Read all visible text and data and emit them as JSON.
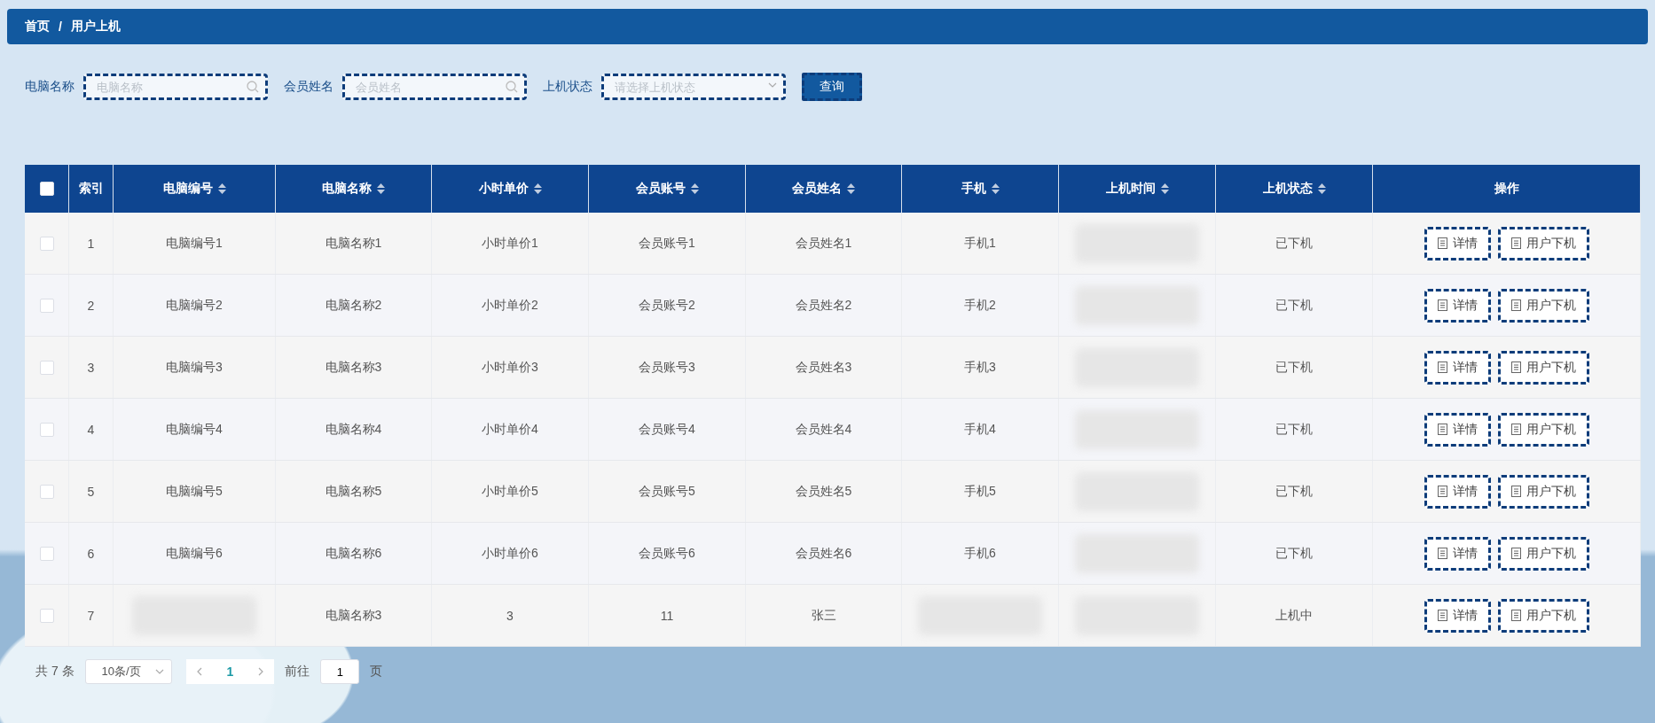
{
  "breadcrumb": [
    "首页",
    "用户上机"
  ],
  "breadcrumb_separator": "/",
  "filters": [
    {
      "label": "电脑名称",
      "placeholder": "电脑名称",
      "kind": "search"
    },
    {
      "label": "会员姓名",
      "placeholder": "会员姓名",
      "kind": "search"
    },
    {
      "label": "上机状态",
      "placeholder": "请选择上机状态",
      "kind": "select"
    }
  ],
  "query_button": "查询",
  "table": {
    "select_all_checked": false,
    "columns": [
      {
        "label": "索引",
        "sortable": false
      },
      {
        "label": "电脑编号",
        "sortable": true
      },
      {
        "label": "电脑名称",
        "sortable": true
      },
      {
        "label": "小时单价",
        "sortable": true
      },
      {
        "label": "会员账号",
        "sortable": true
      },
      {
        "label": "会员姓名",
        "sortable": true
      },
      {
        "label": "手机",
        "sortable": true
      },
      {
        "label": "上机时间",
        "sortable": true
      },
      {
        "label": "上机状态",
        "sortable": true
      },
      {
        "label": "操作",
        "sortable": false
      }
    ],
    "rows": [
      {
        "checked": false,
        "cells": [
          "1",
          "电脑编号1",
          "电脑名称1",
          "小时单价1",
          "会员账号1",
          "会员姓名1",
          "手机1",
          null,
          "已下机"
        ],
        "actions": [
          "详情",
          "用户下机"
        ]
      },
      {
        "checked": false,
        "cells": [
          "2",
          "电脑编号2",
          "电脑名称2",
          "小时单价2",
          "会员账号2",
          "会员姓名2",
          "手机2",
          null,
          "已下机"
        ],
        "actions": [
          "详情",
          "用户下机"
        ]
      },
      {
        "checked": false,
        "cells": [
          "3",
          "电脑编号3",
          "电脑名称3",
          "小时单价3",
          "会员账号3",
          "会员姓名3",
          "手机3",
          null,
          "已下机"
        ],
        "actions": [
          "详情",
          "用户下机"
        ]
      },
      {
        "checked": false,
        "cells": [
          "4",
          "电脑编号4",
          "电脑名称4",
          "小时单价4",
          "会员账号4",
          "会员姓名4",
          "手机4",
          null,
          "已下机"
        ],
        "actions": [
          "详情",
          "用户下机"
        ]
      },
      {
        "checked": false,
        "cells": [
          "5",
          "电脑编号5",
          "电脑名称5",
          "小时单价5",
          "会员账号5",
          "会员姓名5",
          "手机5",
          null,
          "已下机"
        ],
        "actions": [
          "详情",
          "用户下机"
        ]
      },
      {
        "checked": false,
        "cells": [
          "6",
          "电脑编号6",
          "电脑名称6",
          "小时单价6",
          "会员账号6",
          "会员姓名6",
          "手机6",
          null,
          "已下机"
        ],
        "actions": [
          "详情",
          "用户下机"
        ]
      },
      {
        "checked": false,
        "cells": [
          "7",
          null,
          "电脑名称3",
          "3",
          "11",
          "张三",
          null,
          null,
          "上机中"
        ],
        "actions": [
          "详情",
          "用户下机"
        ]
      }
    ]
  },
  "pagination": {
    "total": "共 7 条",
    "page_size": "10条/页",
    "pages": [
      {
        "label": "1",
        "selected": true
      }
    ],
    "goto_label": "前往",
    "goto_value": "1",
    "goto_suffix": "页"
  }
}
